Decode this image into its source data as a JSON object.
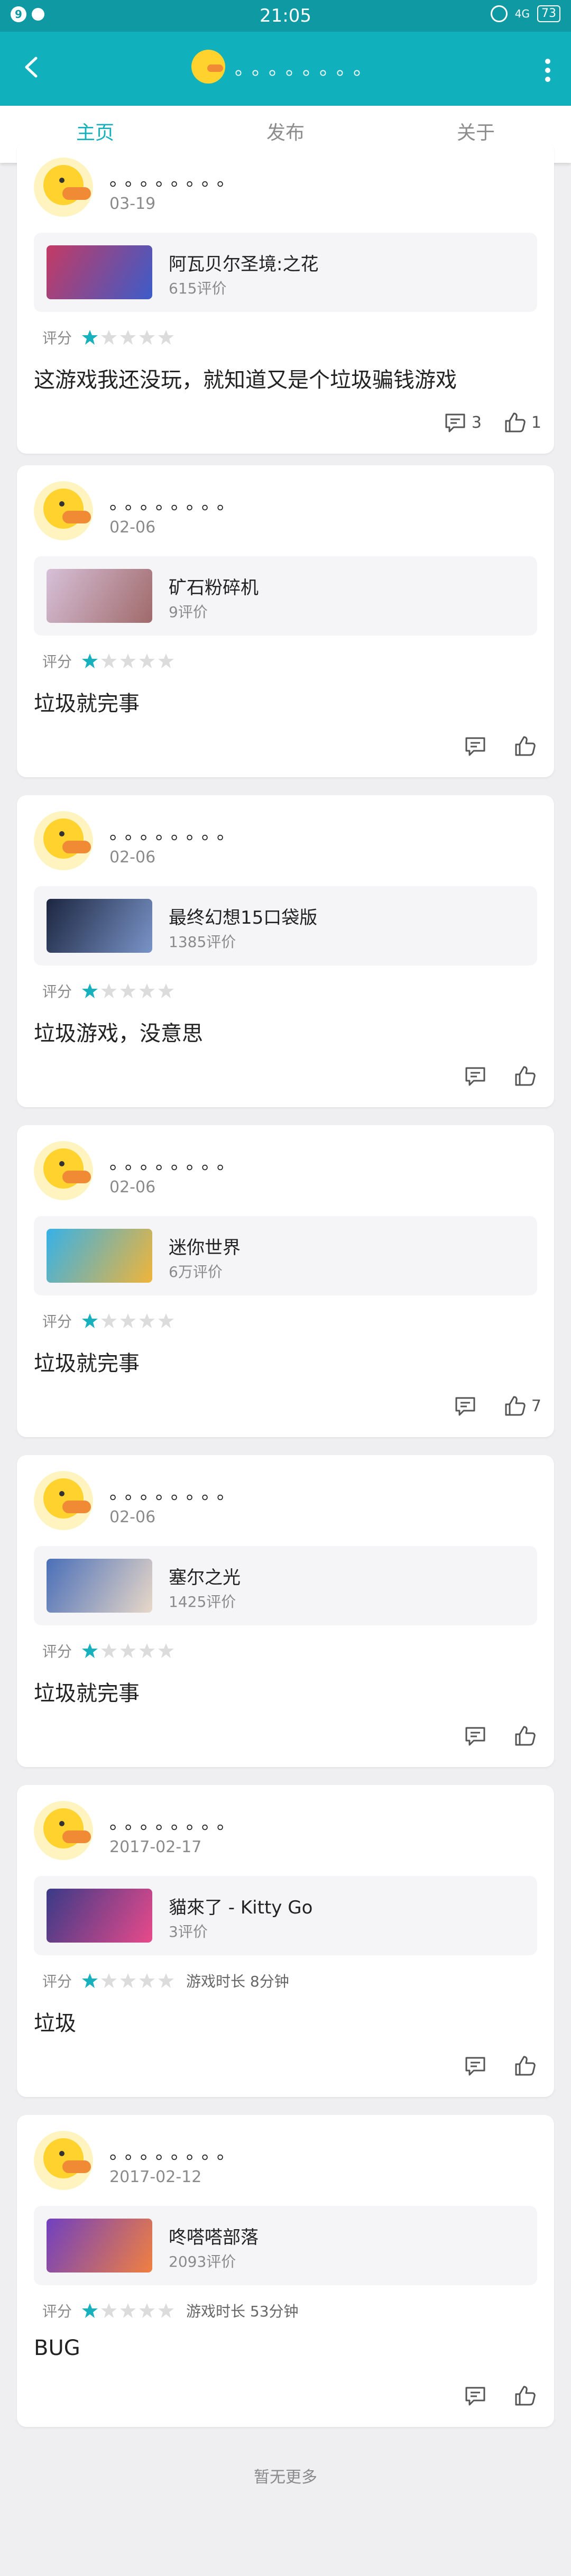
{
  "status_bar": {
    "time": "21:05",
    "battery": "73",
    "signal": "4G"
  },
  "app_bar": {
    "title": "。。。。。。。。"
  },
  "tabs": [
    {
      "label": "主页"
    },
    {
      "label": "发布"
    },
    {
      "label": "关于"
    }
  ],
  "colors": {
    "accent": "#10b1bd",
    "status_bar": "#0f9aa3",
    "star": "#17b0bd",
    "star_empty": "#dcdcdc"
  },
  "reviews": [
    {
      "user": "。。。。。。。。",
      "date": "03-19",
      "game": "阿瓦贝尔圣境:之花",
      "game_count": "615评价",
      "rating_label": "评分",
      "stars": 1,
      "playtime": "",
      "text": "这游戏我还没玩，就知道又是个垃圾骗钱游戏",
      "comments": "3",
      "likes": "1"
    },
    {
      "user": "。。。。。。。。",
      "date": "02-06",
      "game": "矿石粉碎机",
      "game_count": "9评价",
      "rating_label": "评分",
      "stars": 1,
      "playtime": "",
      "text": "垃圾就完事",
      "comments": "",
      "likes": ""
    },
    {
      "user": "。。。。。。。。",
      "date": "02-06",
      "game": "最终幻想15口袋版",
      "game_count": "1385评价",
      "rating_label": "评分",
      "stars": 1,
      "playtime": "",
      "text": "垃圾游戏，没意思",
      "comments": "",
      "likes": ""
    },
    {
      "user": "。。。。。。。。",
      "date": "02-06",
      "game": "迷你世界",
      "game_count": "6万评价",
      "rating_label": "评分",
      "stars": 1,
      "playtime": "",
      "text": "垃圾就完事",
      "comments": "",
      "likes": "7"
    },
    {
      "user": "。。。。。。。。",
      "date": "02-06",
      "game": "塞尔之光",
      "game_count": "1425评价",
      "rating_label": "评分",
      "stars": 1,
      "playtime": "",
      "text": "垃圾就完事",
      "comments": "",
      "likes": ""
    },
    {
      "user": "。。。。。。。。",
      "date": "2017-02-17",
      "game": "貓來了 - Kitty Go",
      "game_count": "3评价",
      "rating_label": "评分",
      "stars": 1,
      "playtime": "游戏时长 8分钟",
      "text": "垃圾",
      "comments": "",
      "likes": ""
    },
    {
      "user": "。。。。。。。。",
      "date": "2017-02-12",
      "game": "咚嗒嗒部落",
      "game_count": "2093评价",
      "rating_label": "评分",
      "stars": 1,
      "playtime": "游戏时长 53分钟",
      "text": "BUG",
      "comments": "",
      "likes": ""
    }
  ],
  "footer": {
    "no_more": "暂无更多"
  }
}
